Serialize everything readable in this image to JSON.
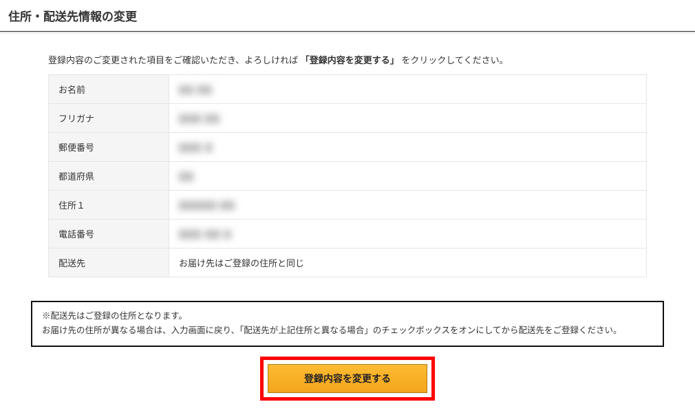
{
  "page_title": "住所・配送先情報の変更",
  "instruction_prefix": "登録内容のご変更された項目をご確認いただき、よろしければ",
  "instruction_bold": "「登録内容を変更する」",
  "instruction_suffix": "をクリックしてください。",
  "fields": {
    "name": {
      "label": "お名前",
      "value": "▇▇ ▇▇",
      "blurred": true
    },
    "furigana": {
      "label": "フリガナ",
      "value": "▇▇▇ ▇▇",
      "blurred": true
    },
    "postal": {
      "label": "郵便番号",
      "value": "▇▇▇‑▇",
      "blurred": true
    },
    "prefecture": {
      "label": "都道府県",
      "value": "▇▇",
      "blurred": true
    },
    "address1": {
      "label": "住所１",
      "value": "▇▇▇▇▇ ▇▇",
      "blurred": true
    },
    "phone": {
      "label": "電話番号",
      "value": "▇▇▇‑▇▇‑▇",
      "blurred": true
    },
    "shipping": {
      "label": "配送先",
      "value": "お届け先はご登録の住所と同じ",
      "blurred": false
    }
  },
  "note_line1": "※配送先はご登録の住所となります。",
  "note_line2": "お届け先の住所が異なる場合は、入力画面に戻り、「配送先が上記住所と異なる場合」のチェックボックスをオンにしてから配送先をご登録ください。",
  "submit_label": "登録内容を変更する"
}
